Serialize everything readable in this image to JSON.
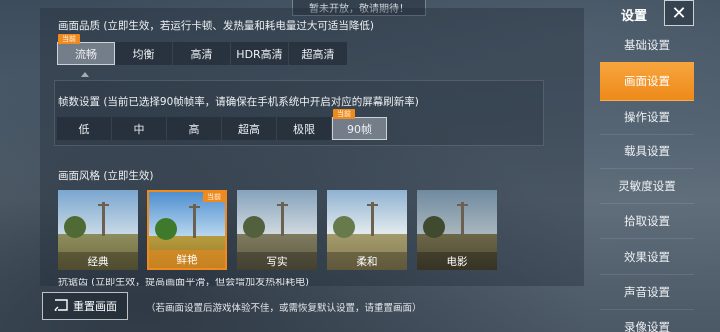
{
  "top_notice": "暂未开放，敬请期待！",
  "quality": {
    "title": "画面品质 (立即生效，若运行卡顿、发热量和耗电量过大可适当降低)",
    "badge": "当前",
    "options": [
      "流畅",
      "均衡",
      "高清",
      "HDR高清",
      "超高清"
    ],
    "selected": "流畅"
  },
  "fps": {
    "title": "帧数设置 (当前已选择90帧帧率，请确保在手机系统中开启对应的屏幕刷新率)",
    "badge": "当前",
    "options": [
      "低",
      "中",
      "高",
      "超高",
      "极限",
      "90帧"
    ],
    "selected": "90帧"
  },
  "style": {
    "title": "画面风格 (立即生效)",
    "badge": "当前",
    "options": [
      "经典",
      "鲜艳",
      "写实",
      "柔和",
      "电影"
    ],
    "selected": "鲜艳"
  },
  "cut_off_text": "抗锯齿 (立即生效，提高画面平滑，但会增加发热和耗电)",
  "reset": {
    "label": "重置画面",
    "note": "（若画面设置后游戏体验不佳，或需恢复默认设置，请重置画面）"
  },
  "nav": {
    "title": "设置",
    "close_icon": "close-icon",
    "items": [
      "基础设置",
      "画面设置",
      "操作设置",
      "载具设置",
      "灵敏度设置",
      "拾取设置",
      "效果设置",
      "声音设置",
      "录像设置"
    ],
    "active": "画面设置"
  },
  "colors": {
    "accent": "#f08a1c"
  }
}
